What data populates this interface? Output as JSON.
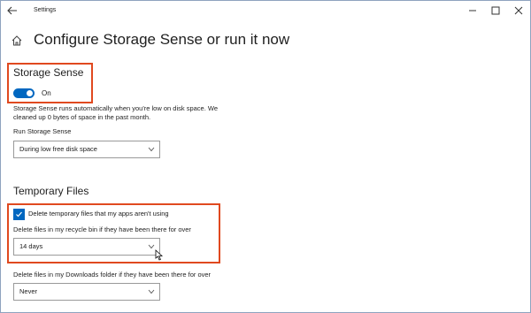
{
  "window": {
    "title": "Settings"
  },
  "header": {
    "page_title": "Configure Storage Sense or run it now"
  },
  "storage_sense": {
    "section_title": "Storage Sense",
    "toggle_label": "On",
    "toggle_on": true,
    "description_line1": "Storage Sense runs automatically when you're low on disk space. We",
    "description_line2": "cleaned up 0 bytes of space in the past month.",
    "run_label": "Run Storage Sense",
    "run_value": "During low free disk space"
  },
  "temporary_files": {
    "section_title": "Temporary Files",
    "delete_temp_label": "Delete temporary files that my apps aren't using",
    "delete_temp_checked": true,
    "recycle_label": "Delete files in my recycle bin if they have been there for over",
    "recycle_value": "14 days",
    "downloads_label": "Delete files in my Downloads folder if they have been there for over",
    "downloads_value": "Never"
  },
  "colors": {
    "accent": "#0067c0",
    "highlight": "#e0491f"
  }
}
